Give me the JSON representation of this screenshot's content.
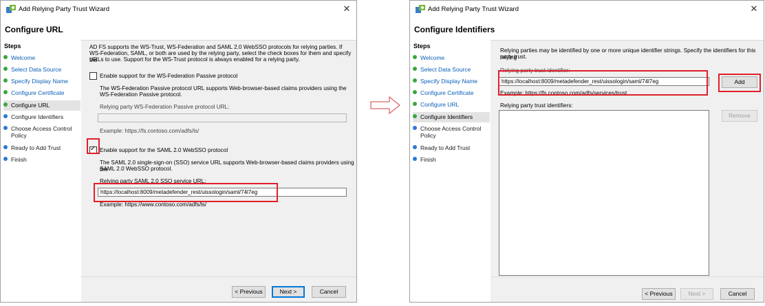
{
  "window_left": {
    "title": "Add Relying Party Trust Wizard",
    "page_title": "Configure URL",
    "steps_title": "Steps",
    "steps": [
      {
        "label": "Welcome",
        "state": "done"
      },
      {
        "label": "Select Data Source",
        "state": "done"
      },
      {
        "label": "Specify Display Name",
        "state": "done"
      },
      {
        "label": "Configure Certificate",
        "state": "done"
      },
      {
        "label": "Configure URL",
        "state": "current"
      },
      {
        "label": "Configure Identifiers",
        "state": "pending"
      },
      {
        "label": "Choose Access Control Policy",
        "state": "pending"
      },
      {
        "label": "Ready to Add Trust",
        "state": "pending"
      },
      {
        "label": "Finish",
        "state": "pending"
      }
    ],
    "intro_line1": "AD FS supports the WS-Trust, WS-Federation and SAML 2.0 WebSSO protocols for relying parties.  If",
    "intro_line2": "WS-Federation, SAML, or both are used by the relying party, select the check boxes for them and specify the",
    "intro_line3": "URLs to use.  Support for the WS-Trust protocol is always enabled for a relying party.",
    "wsfed_checkbox_label": "Enable support for the WS-Federation Passive protocol",
    "wsfed_checked": false,
    "wsfed_desc_line1": "The WS-Federation Passive protocol URL supports Web-browser-based claims providers using the",
    "wsfed_desc_line2": "WS-Federation Passive protocol.",
    "wsfed_url_label": "Relying party WS-Federation Passive protocol URL:",
    "wsfed_url_value": "",
    "wsfed_example": "Example: https://fs.contoso.com/adfs/ls/",
    "saml_checkbox_label": "Enable support for the SAML 2.0 WebSSO protocol",
    "saml_checked": true,
    "saml_desc_line1": "The SAML 2.0 single-sign-on (SSO) service URL supports Web-browser-based claims providers using the",
    "saml_desc_line2": "SAML 2.0 WebSSO protocol.",
    "saml_url_label": "Relying party SAML 2.0 SSO service URL:",
    "saml_url_value": "https://localhost:8009/metadefender_rest/uissologin/saml/74l7eg",
    "saml_example": "Example: https://www.contoso.com/adfs/ls/",
    "buttons": {
      "previous": "< Previous",
      "next": "Next >",
      "cancel": "Cancel"
    }
  },
  "window_right": {
    "title": "Add Relying Party Trust Wizard",
    "page_title": "Configure Identifiers",
    "steps_title": "Steps",
    "steps": [
      {
        "label": "Welcome",
        "state": "done"
      },
      {
        "label": "Select Data Source",
        "state": "done"
      },
      {
        "label": "Specify Display Name",
        "state": "done"
      },
      {
        "label": "Configure Certificate",
        "state": "done"
      },
      {
        "label": "Configure URL",
        "state": "done"
      },
      {
        "label": "Configure Identifiers",
        "state": "current"
      },
      {
        "label": "Choose Access Control Policy",
        "state": "pending"
      },
      {
        "label": "Ready to Add Trust",
        "state": "pending"
      },
      {
        "label": "Finish",
        "state": "pending"
      }
    ],
    "intro_line1": "Relying parties may be identified by one or more unique identifier strings. Specify the identifiers for this relying",
    "intro_line2": "party trust.",
    "identifier_label": "Relying party trust identifier:",
    "identifier_value": "https://localhost:8009/metadefender_rest/uissologin/saml/74l7eg",
    "identifier_example": "Example: https://fs.contoso.com/adfs/services/trust",
    "identifiers_list_label": "Relying party trust identifiers:",
    "add_button": "Add",
    "remove_button": "Remove",
    "buttons": {
      "previous": "< Previous",
      "next": "Next >",
      "cancel": "Cancel"
    }
  },
  "colors": {
    "highlight": "#e01e2a",
    "done_step": "#3ca63c",
    "pending_step": "#2b78d4",
    "primary_border": "#0078d7"
  },
  "icons": {
    "app": "adfs-wizard-icon",
    "close": "close-icon",
    "arrow": "right-arrow-icon"
  }
}
